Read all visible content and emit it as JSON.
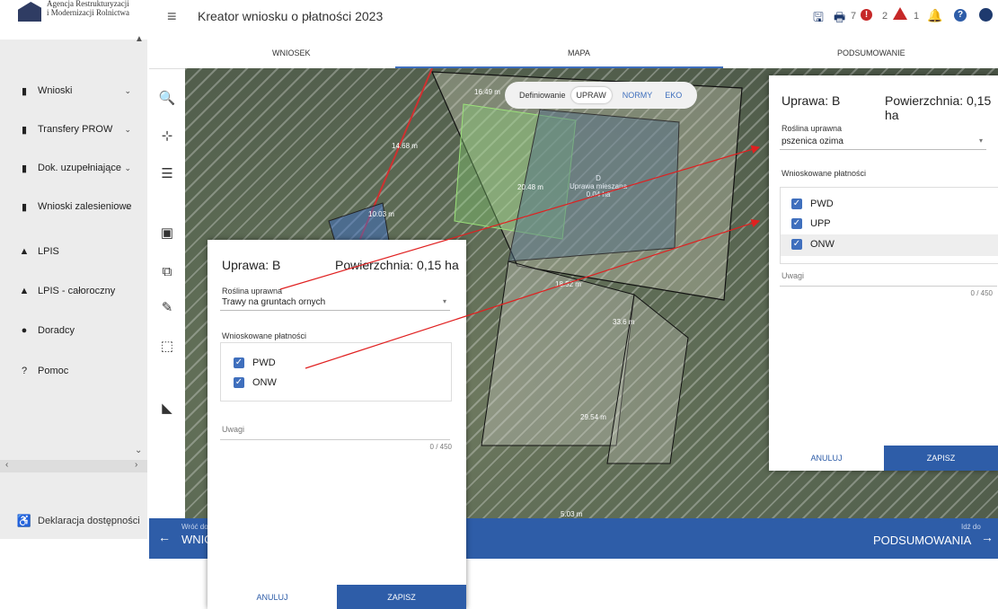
{
  "header": {
    "logo_line1": "Agencja Restrukturyzacji",
    "logo_line2": "i Modernizacji Rolnictwa",
    "title": "Kreator wniosku o płatności 2023",
    "count_print": "7",
    "count_info": "2",
    "count_warning": "1"
  },
  "sidebar": {
    "items": [
      {
        "label": "Wnioski",
        "has_chevron": true
      },
      {
        "label": "Transfery PROW",
        "has_chevron": true
      },
      {
        "label": "Dok. uzupełniające",
        "has_chevron": true
      },
      {
        "label": "Wnioski zalesieniowe",
        "has_chevron": true
      },
      {
        "label": "LPIS",
        "has_chevron": false
      },
      {
        "label": "LPIS - całoroczny",
        "has_chevron": false
      },
      {
        "label": "Doradcy",
        "has_chevron": false
      },
      {
        "label": "Pomoc",
        "has_chevron": false
      }
    ],
    "declaration": "Deklaracja dostępności"
  },
  "tabs": [
    {
      "label": "WNIOSEK",
      "active": false
    },
    {
      "label": "MAPA",
      "active": true
    },
    {
      "label": "PODSUMOWANIE",
      "active": false
    }
  ],
  "map": {
    "definition_label": "Definiowanie",
    "mode_uprawy": "UPRAW",
    "mode_normy": "NORMY",
    "mode_eko": "EKO",
    "parcel_label_line1": "D",
    "parcel_label_line2": "Uprawa mieszana",
    "parcel_label_line3": "0.04 ha",
    "measurements": [
      "16.49 m",
      "14.68 m",
      "20.48 m",
      "10.03 m",
      "18.52 m",
      "33.6 m",
      "29.54 m",
      "5.03 m"
    ]
  },
  "bottom_nav": {
    "back_small": "Wróć do",
    "back_big": "WNIOSKU",
    "next_small": "Idź do",
    "next_big": "PODSUMOWANIA"
  },
  "panel_right": {
    "title": "Uprawa: B",
    "area": "Powierzchnia: 0,15 ha",
    "crop_label": "Roślina uprawna",
    "crop_value": "pszenica ozima",
    "payments_label": "Wnioskowane płatności",
    "payments": [
      "PWD",
      "UPP",
      "ONW"
    ],
    "notes_label": "Uwagi",
    "counter": "0 / 450",
    "cancel": "ANULUJ",
    "save": "ZAPISZ"
  },
  "panel_left": {
    "title": "Uprawa: B",
    "area": "Powierzchnia: 0,15 ha",
    "crop_label": "Roślina uprawna",
    "crop_value": "Trawy na gruntach ornych",
    "payments_label": "Wnioskowane płatności",
    "payments": [
      "PWD",
      "ONW"
    ],
    "notes_label": "Uwagi",
    "counter": "0 / 450",
    "cancel": "ANULUJ",
    "save": "ZAPISZ"
  },
  "colors": {
    "brand_blue": "#2e5da8",
    "alert_red": "#c62828",
    "annotation_arrow": "#e02020"
  }
}
